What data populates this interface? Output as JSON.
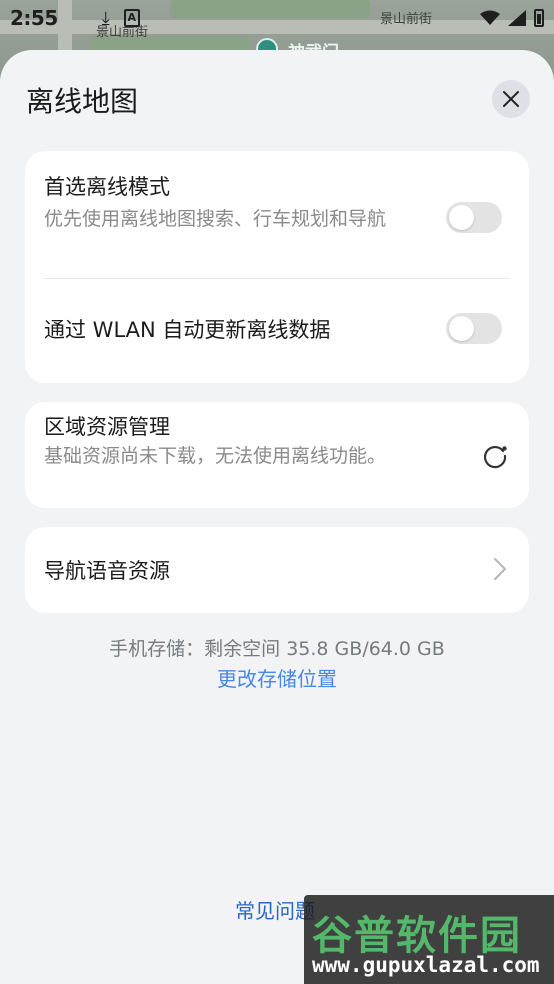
{
  "status_bar": {
    "time": "2:55",
    "download_icon": "download-icon",
    "a_icon_label": "A"
  },
  "map": {
    "labels": [
      "景山前街",
      "景山前街",
      "神武门"
    ]
  },
  "sheet": {
    "title": "离线地图",
    "close_icon": "close-icon"
  },
  "settings": {
    "preferred_offline": {
      "title": "首选离线模式",
      "subtitle": "优先使用离线地图搜索、行车规划和导航",
      "enabled": false
    },
    "wlan_auto_update": {
      "title": "通过 WLAN 自动更新离线数据",
      "enabled": false
    },
    "region_resources": {
      "title": "区域资源管理",
      "subtitle": "基础资源尚未下载，无法使用离线功能。"
    },
    "voice_resources": {
      "title": "导航语音资源"
    }
  },
  "storage": {
    "text": "手机存储：剩余空间 35.8 GB/64.0 GB",
    "change_link": "更改存储位置"
  },
  "faq_link": "常见问题",
  "watermark": {
    "logo_text": "谷普软件园",
    "url": "www.gupuxlazal.com"
  },
  "colors": {
    "accent_link": "#4a86e6",
    "sheet_bg": "#f1f3f5",
    "card_bg": "#ffffff",
    "toggle_off": "#e3e3e3"
  }
}
